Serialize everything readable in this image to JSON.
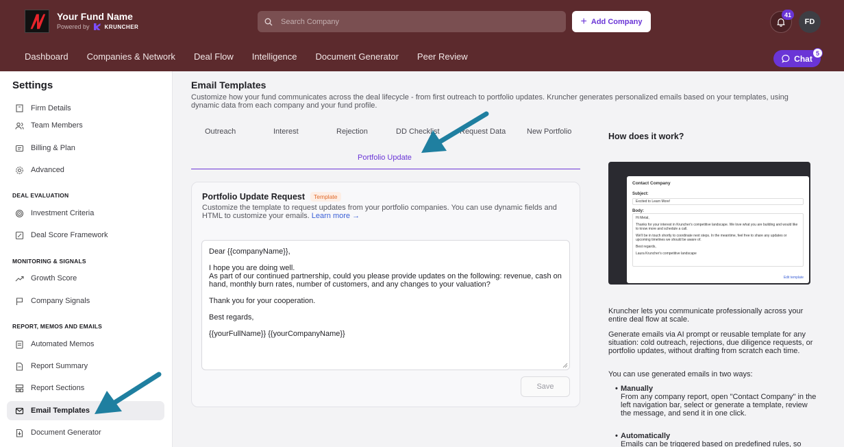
{
  "header": {
    "fund_name": "Your Fund Name",
    "powered_by": "Powered by",
    "brand": "KRUNCHER",
    "search_placeholder": "Search Company",
    "add_company_label": "Add Company",
    "notification_count": "41",
    "avatar_initials": "FD",
    "chat_label": "Chat",
    "chat_count": "5",
    "brand_color": "#5c2a2d",
    "accent_color": "#6a35d6"
  },
  "nav": [
    "Dashboard",
    "Companies & Network",
    "Deal Flow",
    "Intelligence",
    "Document Generator",
    "Peer Review"
  ],
  "sidebar": {
    "title": "Settings",
    "items_top": [
      {
        "label": "Firm Details",
        "icon": "building-icon"
      },
      {
        "label": "Team Members",
        "icon": "users-icon"
      },
      {
        "label": "Billing & Plan",
        "icon": "credit-card-icon"
      },
      {
        "label": "Advanced",
        "icon": "gear-icon"
      }
    ],
    "section_deal": "DEAL EVALUATION",
    "items_deal": [
      {
        "label": "Investment Criteria",
        "icon": "target-icon"
      },
      {
        "label": "Deal Score Framework",
        "icon": "score-icon"
      }
    ],
    "section_monitoring": "MONITORING & SIGNALS",
    "items_monitoring": [
      {
        "label": "Growth Score",
        "icon": "trend-icon"
      },
      {
        "label": "Company Signals",
        "icon": "flag-icon"
      }
    ],
    "section_report": "REPORT, MEMOS AND EMAILS",
    "items_report": [
      {
        "label": "Automated Memos",
        "icon": "memo-icon"
      },
      {
        "label": "Report Summary",
        "icon": "document-icon"
      },
      {
        "label": "Report Sections",
        "icon": "sections-icon"
      },
      {
        "label": "Email Templates",
        "icon": "mail-icon"
      },
      {
        "label": "Document Generator",
        "icon": "doc-download-icon"
      }
    ]
  },
  "main": {
    "title": "Email Templates",
    "description": "Customize how your fund communicates across the deal lifecycle - from first outreach to portfolio updates. Kruncher generates personalized emails based on your templates, using dynamic data from each company and your fund profile.",
    "tabs": [
      "Outreach",
      "Interest",
      "Rejection",
      "DD Checklist",
      "Request Data",
      "New Portfolio",
      "Portfolio Update"
    ],
    "active_tab": "Portfolio Update"
  },
  "card": {
    "title": "Portfolio Update Request",
    "badge": "Template",
    "description": "Customize the template to request updates from your portfolio companies. You can use dynamic fields and HTML to customize your emails.",
    "learn_more": "Learn more →",
    "body_lines": [
      "Dear {{companyName}},",
      "",
      "I hope you are doing well.",
      "As part of our continued partnership, could you please provide updates on the following: revenue, cash on hand, monthly burn rates, number of customers, and any changes to your valuation?",
      "",
      "Thank you for your cooperation.",
      "",
      "Best regards,",
      "",
      "{{yourFullName}} {{yourCompanyName}}"
    ],
    "save_label": "Save"
  },
  "help": {
    "title": "How does it work?",
    "preview": {
      "heading": "Contact Company",
      "subject_label": "Subject:",
      "subject_value": "Excited to Learn More!",
      "body_label": "Body:",
      "body_lines": [
        "Hi Metal,",
        "Thanks for your interest in Kruncher's competitive landscape. We love what you are building and would like to know more and schedule a call.",
        "We'll be in touch shortly to coordinate next steps. In the meantime, feel free to share any updates or upcoming timelines we should be aware of.",
        "Best regards,",
        "Laura Kruncher's competitive landscape"
      ],
      "edit_link": "Edit template"
    },
    "para1": "Kruncher lets you communicate professionally across your entire deal flow at scale.",
    "para2": "Generate emails via AI prompt or reusable template for any situation: cold outreach, rejections, due diligence requests, or portfolio updates, without drafting from scratch each time.",
    "para3": "You can use generated emails in two ways:",
    "bullet1_title": "Manually",
    "bullet1_text": "From any company report, open \"Contact Company\" in the left navigation bar, select or generate a template, review the message, and send it in one click.",
    "bullet2_title": "Automatically",
    "bullet2_text": "Emails can be triggered based on predefined rules, so"
  }
}
